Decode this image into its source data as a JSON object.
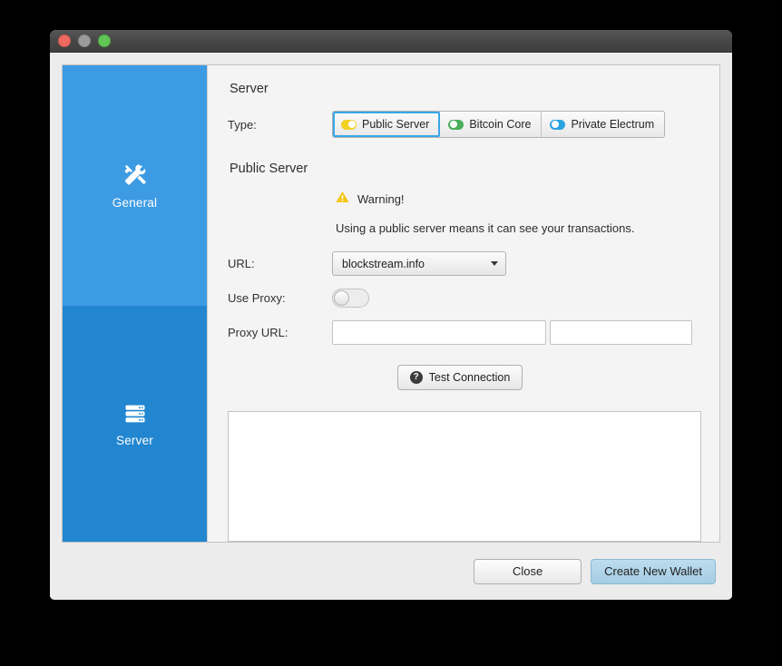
{
  "window": {
    "traffic_lights": [
      {
        "name": "close",
        "color": "#ec6a5f"
      },
      {
        "name": "minimize",
        "color": "#9b9b9b"
      },
      {
        "name": "zoom",
        "color": "#61c555"
      }
    ]
  },
  "sidebar": {
    "items": [
      {
        "label": "General",
        "icon": "tools-icon",
        "selected": false,
        "bg": "#3d9be3"
      },
      {
        "label": "Server",
        "icon": "server-rack-icon",
        "selected": true,
        "bg": "#2286d0"
      }
    ]
  },
  "main": {
    "server_section": {
      "title": "Server",
      "type_label": "Type:",
      "options": [
        {
          "label": "Public Server",
          "toggle_color": "#f2d024",
          "toggle_state": "on",
          "selected": true
        },
        {
          "label": "Bitcoin Core",
          "toggle_color": "#4aad5a",
          "toggle_state": "off",
          "selected": false
        },
        {
          "label": "Private Electrum",
          "toggle_color": "#2aa3e0",
          "toggle_state": "off",
          "selected": false
        }
      ]
    },
    "public_server_section": {
      "title": "Public Server",
      "warning_label": "Warning!",
      "warning_description": "Using a public server means it can see your transactions.",
      "url_label": "URL:",
      "url_value": "blockstream.info",
      "use_proxy_label": "Use Proxy:",
      "use_proxy_state": "off",
      "proxy_url_label": "Proxy URL:",
      "proxy_host_value": "",
      "proxy_host_placeholder": "",
      "proxy_port_value": "",
      "proxy_port_placeholder": "",
      "test_connection_label": "Test Connection",
      "test_connection_icon": "help-circle-icon",
      "log_value": "",
      "log_placeholder": ""
    }
  },
  "footer": {
    "close_label": "Close",
    "create_wallet_label": "Create New Wallet",
    "primary_color": "#a5cde4"
  }
}
